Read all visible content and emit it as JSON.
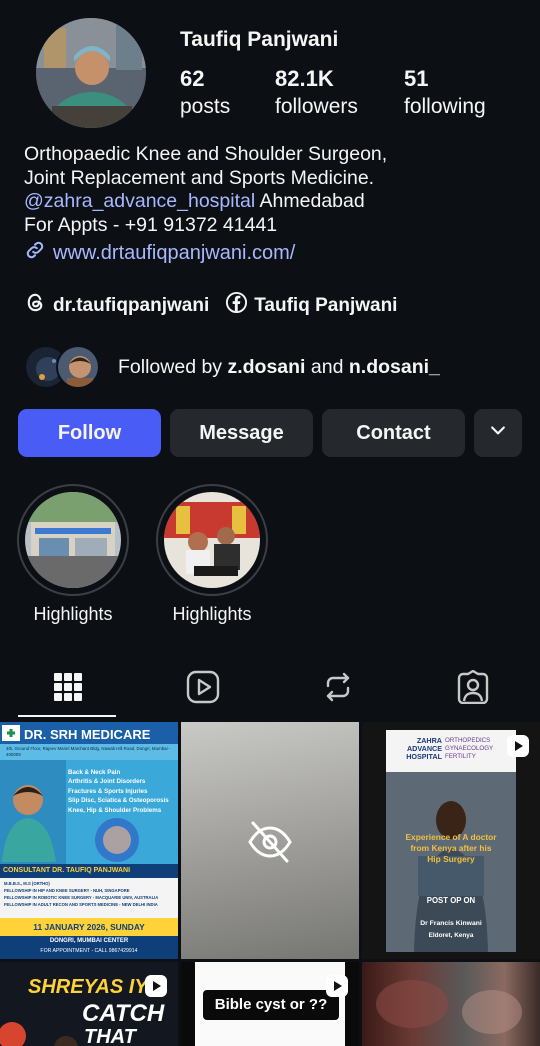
{
  "profile": {
    "name": "Taufiq Panjwani",
    "stats": [
      {
        "value": "62",
        "label": "posts"
      },
      {
        "value": "82.1K",
        "label": "followers"
      },
      {
        "value": "51",
        "label": "following"
      }
    ],
    "bio": {
      "line1": "Orthopaedic Knee and Shoulder Surgeon,",
      "line2": "Joint Replacement and Sports Medicine.",
      "mention": "@zahra_advance_hospital",
      "location": " Ahmedabad",
      "line4": "For Appts - +91 91372 41441"
    },
    "website": "www.drtaufiqpanjwani.com/",
    "threads_handle": "dr.taufiqpanjwani",
    "facebook_name": "Taufiq Panjwani",
    "followed_by": {
      "prefix": "Followed by ",
      "user1": "z.dosani",
      "joiner": " and ",
      "user2": "n.dosani_"
    }
  },
  "actions": {
    "follow": "Follow",
    "message": "Message",
    "contact": "Contact"
  },
  "highlights": [
    {
      "label": "Highlights"
    },
    {
      "label": "Highlights"
    }
  ],
  "tabs": [
    {
      "name": "grid-icon",
      "active": true
    },
    {
      "name": "reels-icon",
      "active": false
    },
    {
      "name": "reposts-icon",
      "active": false
    },
    {
      "name": "tagged-icon",
      "active": false
    }
  ],
  "posts": {
    "post1": {
      "title": "DR. SRH MEDICARE",
      "address": "4th, Ground Floor, Rajeev Mariel Marchant Bldg, Nawab Hill Road, Dongri, Mumbai - 400009",
      "services": [
        "Back & Neck Pain",
        "Arthritis & Joint Disorders",
        "Fractures & Sports Injuries",
        "Slip Disc, Sciatica & Osteoporosis",
        "Knee, Hip & Shoulder Problems"
      ],
      "doctor": "CONSULTANT DR. TAUFIQ PANJWANI",
      "degree": "M.B.B.S., M.S (ORTHO)",
      "fellowships": [
        "FELLOWSHIP IN HIP AND KNEE SURGERY - NUH, SINGAPORE",
        "FELLOWSHIP IN ROBOTIC KNEE SURGERY - MACQUARIE UNIV, AUSTRALIA",
        "FELLOWSHIP IN ADULT RECON AND SPORTS MEDICINE - NEW DELHI INDIA"
      ],
      "date": "11 JANUARY 2026, SUNDAY",
      "venue": "DONGRI, MUMBAI CENTER",
      "appointment": "FOR APPOINTMENT - CALL 9867429914"
    },
    "post3": {
      "hospital_a": "ZAHRA",
      "hospital_b": "ADVANCE",
      "hospital_c": "HOSPITAL",
      "dept_a": "ORTHOPEDICS",
      "dept_b": "GYNAECOLOGY",
      "dept_c": "FERTILITY",
      "caption_1": "Experience of A doctor",
      "caption_2": "from Kenya after his",
      "caption_3": "Hip Surgery",
      "tag": "POST OP ON",
      "patient": "Dr Francis Kinwani",
      "place": "Eldoret, Kenya"
    },
    "post4": {
      "line1": "SHREYAS IYE",
      "line2": "CATCH",
      "line3": "THAT"
    },
    "post5": {
      "caption": "Bible cyst or ??"
    }
  },
  "colors": {
    "background": "#0c1014",
    "primary_button": "#4a5cf6",
    "secondary_button": "#25292e",
    "link": "#a8b8ff"
  }
}
